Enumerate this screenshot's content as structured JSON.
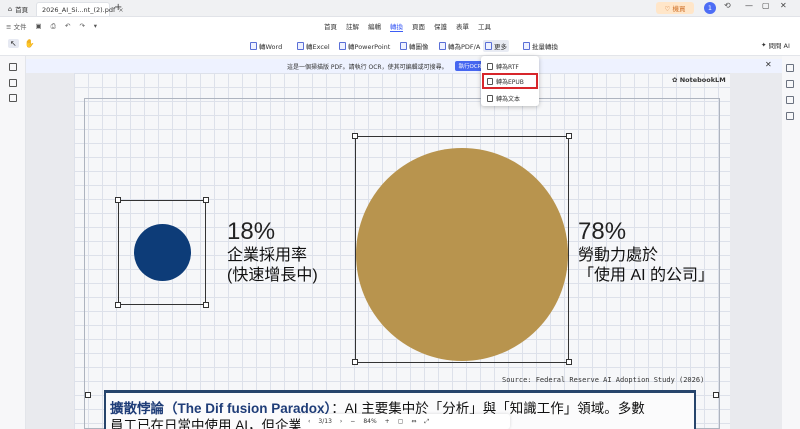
{
  "tabs": {
    "home": "首頁",
    "document": "2026_AI_Si...nt_(2).pdf"
  },
  "titlebar": {
    "upgrade": "♡ 機買",
    "avatar": "1"
  },
  "menu": {
    "file": "文件",
    "items": [
      "首頁",
      "註解",
      "編輯",
      "轉換",
      "頁面",
      "保護",
      "表單",
      "工具"
    ],
    "active_index": 3
  },
  "ribbon": {
    "to_word": "轉Word",
    "to_excel": "轉Excel",
    "to_ppt": "轉PowerPoint",
    "to_image": "轉圖像",
    "to_pdfa": "轉為PDF/A",
    "more": "更多",
    "batch": "批量轉換",
    "ai": "問問 AI"
  },
  "notice": {
    "text": "這是一個掃描版 PDF。請執行 OCR，使其可編輯或可搜尋。",
    "button": "執行OCR"
  },
  "dropdown": {
    "items": [
      "轉為RTF",
      "轉為EPUB",
      "轉為文本"
    ],
    "highlighted_index": 1
  },
  "document": {
    "watermark": "NotebookLM",
    "left_stat": {
      "percent": "18%",
      "line1": "企業採用率",
      "line2": "(快速增長中)"
    },
    "right_stat": {
      "percent": "78%",
      "line1": "勞動力處於",
      "line2": "「使用 AI 的公司」"
    },
    "source": "Source: Federal Reserve AI Adoption Study (2026)",
    "paradox": {
      "title": "擴散悖論（The Dif fusion Paradox）",
      "line1_rest": "：AI 主要集中於「分析」與「知識工作」領域。多數",
      "line2": "員工已在日常中使用 AI，但企業正式導入的速度仍嚴重滯後。"
    }
  },
  "zoombar": {
    "page": "3/13",
    "zoom": "84%"
  },
  "colors": {
    "accent": "#3d5df5",
    "highlight": "#d7262b",
    "navy": "#0d3c78",
    "gold": "#b8944e"
  }
}
